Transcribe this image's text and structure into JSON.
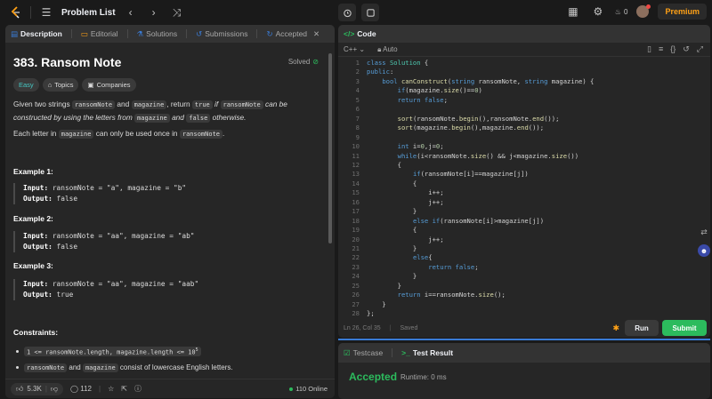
{
  "topbar": {
    "title": "Problem List",
    "streak_count": "0",
    "premium_label": "Premium"
  },
  "tabs": {
    "description": "Description",
    "editorial": "Editorial",
    "solutions": "Solutions",
    "submissions": "Submissions",
    "accepted": "Accepted"
  },
  "problem": {
    "title": "383. Ransom Note",
    "solved": "Solved",
    "difficulty": "Easy",
    "topics": "Topics",
    "companies": "Companies",
    "para1": {
      "t1": "Given two strings ",
      "c1": "ransomNote",
      "t2": " and ",
      "c2": "magazine",
      "t3": ", return ",
      "c3": "true",
      "i1": " if ",
      "c4": "ransomNote",
      "i2": " can be constructed by using the letters from ",
      "c5": "magazine",
      "i3": " and ",
      "c6": "false",
      "i4": " otherwise."
    },
    "para2": {
      "t1": "Each letter in ",
      "c1": "magazine",
      "t2": " can only be used once in ",
      "c2": "ransomNote",
      "t3": "."
    },
    "examples": [
      {
        "heading": "Example 1:",
        "input_label": "Input:",
        "input": " ransomNote = \"a\", magazine = \"b\"",
        "output_label": "Output:",
        "output": " false"
      },
      {
        "heading": "Example 2:",
        "input_label": "Input:",
        "input": " ransomNote = \"aa\", magazine = \"ab\"",
        "output_label": "Output:",
        "output": " false"
      },
      {
        "heading": "Example 3:",
        "input_label": "Input:",
        "input": " ransomNote = \"aa\", magazine = \"aab\"",
        "output_label": "Output:",
        "output": " true"
      }
    ],
    "constraints_heading": "Constraints:",
    "constraint1": "1 <= ransomNote.length, magazine.length <= 10",
    "constraint1_sup": "5",
    "constraint2": {
      "c1": "ransomNote",
      "t1": " and ",
      "c2": "magazine",
      "t2": " consist of lowercase English letters."
    }
  },
  "footer": {
    "likes": "5.3K",
    "comments": "112",
    "online": "110 Online"
  },
  "code_panel": {
    "title": "Code",
    "language": "C++",
    "auto": "Auto",
    "cursor": "Ln 26, Col 35",
    "saved": "Saved",
    "run": "Run",
    "submit": "Submit",
    "lines": [
      "class Solution {",
      "public:",
      "    bool canConstruct(string ransomNote, string magazine) {",
      "        if(magazine.size()==0)",
      "        return false;",
      "",
      "        sort(ransomNote.begin(),ransomNote.end());",
      "        sort(magazine.begin(),magazine.end());",
      "",
      "        int i=0,j=0;",
      "        while(i<ransomNote.size() && j<magazine.size())",
      "        {",
      "            if(ransomNote[i]==magazine[j])",
      "            {",
      "                i++;",
      "                j++;",
      "            }",
      "            else if(ransomNote[i]>magazine[j])",
      "            {",
      "                j++;",
      "            }",
      "            else{",
      "                return false;",
      "            }",
      "        }",
      "        return i==ransomNote.size();",
      "    }",
      "};"
    ]
  },
  "result_panel": {
    "testcase": "Testcase",
    "test_result": "Test Result",
    "status": "Accepted",
    "runtime": "Runtime: 0 ms"
  }
}
